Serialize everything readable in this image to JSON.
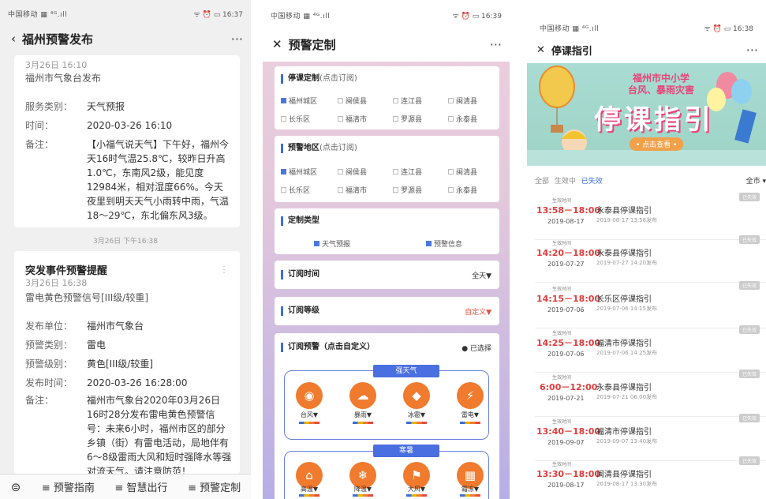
{
  "p1": {
    "status": {
      "left": "中国移动 ▦ ⁴ᴳ.ıll",
      "right": "ᯤ ⏰ ▭ 16:37"
    },
    "nav_title": "福州预警发布",
    "more": "···",
    "card1": {
      "time": "3月26日 16:10",
      "source": "福州市气象台发布",
      "rows": [
        {
          "k": "服务类别：",
          "v": "天气预报"
        },
        {
          "k": "时间：",
          "v": "2020-03-26 16:10"
        },
        {
          "k": "备注：",
          "v": "【小福气说天气】下午好，福州今天16时气温25.8℃，较昨日升高1.0℃，东南风2级，能见度12984米，相对湿度66%。今天夜里到明天天气小雨转中雨，气温18～29℃，东北偏东风3级。"
        }
      ]
    },
    "divider_time": "3月26日 下午16:38",
    "card2": {
      "title": "突发事件预警提醒",
      "time": "3月26日 16:38",
      "signal": "雷电黄色预警信号[III级/较重]",
      "rows": [
        {
          "k": "发布单位：",
          "v": "福州市气象台"
        },
        {
          "k": "预警类别：",
          "v": "雷电"
        },
        {
          "k": "预警级别：",
          "v": "黄色[III级/较重]"
        },
        {
          "k": "发布时间：",
          "v": "2020-03-26 16:28:00"
        },
        {
          "k": "备注：",
          "v": "福州市气象台2020年03月26日16时28分发布雷电黄色预警信号：未来6小时，福州市区的部分乡镇（街）有雷电活动，局地伴有6～8级雷雨大风和短时强降水等强对流天气。请注意防范！"
        }
      ]
    },
    "bottom": [
      "≡ 预警指南",
      "≡ 智慧出行",
      "≡ 预警定制"
    ]
  },
  "p2": {
    "status": {
      "left": "中国移动 ▦ ⁴ᴳ.ıll",
      "right": "ᯤ ⏰ ▭ 16:39"
    },
    "nav_title": "预警定制",
    "more": "···",
    "sec1": {
      "title": "停课定制",
      "hint": "(点击订阅)",
      "items": [
        "福州城区",
        "闽侯县",
        "连江县",
        "闽清县",
        "长乐区",
        "福清市",
        "罗源县",
        "永泰县"
      ]
    },
    "sec2": {
      "title": "预警地区",
      "hint": "(点击订阅)",
      "items": [
        "福州城区",
        "闽侯县",
        "连江县",
        "闽清县",
        "长乐区",
        "福清市",
        "罗源县",
        "永泰县"
      ]
    },
    "sec3": {
      "title": "定制类型",
      "items": [
        "天气预报",
        "预警信息"
      ]
    },
    "sec4": {
      "title": "订阅时间",
      "value": "全天▼"
    },
    "sec5": {
      "title": "订阅等级",
      "value": "自定义▼"
    },
    "sec6": {
      "title": "订阅预警（点击自定义）",
      "value": "● 已选择",
      "group1": {
        "tag": "强天气",
        "items": [
          "台风▼",
          "暴雨▼",
          "冰雹▼",
          "雷电▼"
        ]
      },
      "group2": {
        "tag": "寒暑",
        "items": [
          "高温▼",
          "降温▼",
          "大风▼",
          "霜冻▼"
        ]
      }
    }
  },
  "p3": {
    "status": {
      "left": "中国移动 ▦ ⁴ᴳ.ıll",
      "right": "ᯤ ⏰ ▭ 16:38"
    },
    "nav_title": "停课指引",
    "more": "···",
    "banner": {
      "line1": "福州市中小学",
      "line2": "台风、暴雨灾害",
      "big": "停课指引",
      "btn": "• 点击查看 •"
    },
    "filter": {
      "all": "全部",
      "active": "生效中",
      "expired": "已失效",
      "right": "全市 ▾"
    },
    "items": [
      {
        "label": "生效时间",
        "time": "13:58－18:00",
        "date": "2019-08-17",
        "name": "永泰县停课指引",
        "sub": "2019-08-17 13:58发布",
        "tag": "已失效"
      },
      {
        "label": "生效时间",
        "time": "14:20－18:00",
        "date": "2019-07-27",
        "name": "永泰县停课指引",
        "sub": "2019-07-27 14:20发布",
        "tag": "已失效"
      },
      {
        "label": "生效时间",
        "time": "14:15－18:00",
        "date": "2019-07-06",
        "name": "长乐区停课指引",
        "sub": "2019-07-06 14:15发布",
        "tag": "已失效"
      },
      {
        "label": "生效时间",
        "time": "14:25－18:00",
        "date": "2019-07-06",
        "name": "福清市停课指引",
        "sub": "2019-07-06 14:25发布",
        "tag": "已失效"
      },
      {
        "label": "生效时间",
        "time": "6:00－12:00",
        "date": "2019-07-21",
        "name": "永泰县停课指引",
        "sub": "2019-07-21 06:00发布",
        "tag": "已失效"
      },
      {
        "label": "生效时间",
        "time": "13:40－18:00",
        "date": "2019-09-07",
        "name": "福清市停课指引",
        "sub": "2019-09-07 13:40发布",
        "tag": "已失效"
      },
      {
        "label": "生效时间",
        "time": "13:30－18:00",
        "date": "2019-08-17",
        "name": "闽清县停课指引",
        "sub": "2019-08-17 13:30发布",
        "tag": "已失效"
      }
    ]
  }
}
